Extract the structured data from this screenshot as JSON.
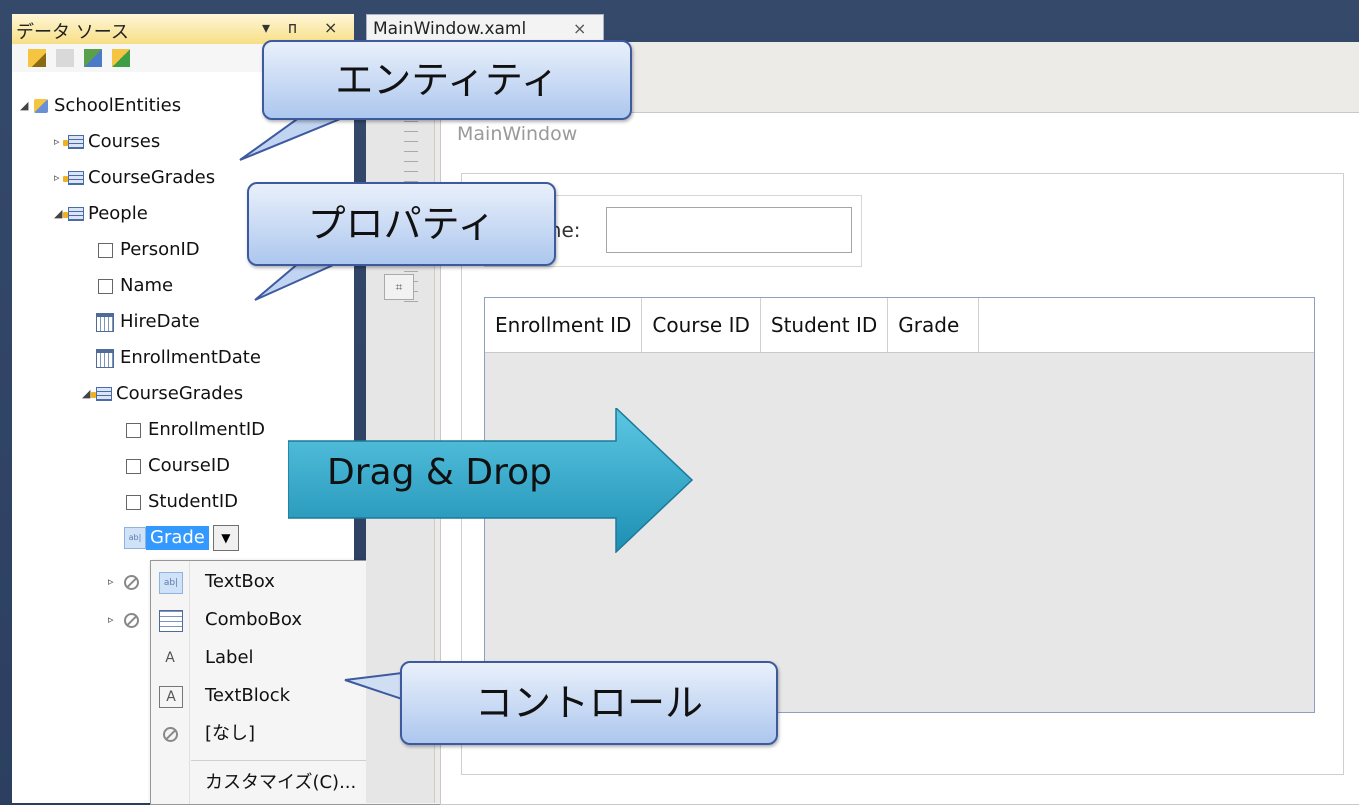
{
  "data_sources": {
    "title": "データ ソース",
    "pin_icon": "pin-icon",
    "close_label": "×",
    "tree": {
      "root": "SchoolEntities",
      "courses": "Courses",
      "course_grades": "CourseGrades",
      "people": "People",
      "person_id": "PersonID",
      "name": "Name",
      "hire_date": "HireDate",
      "enrollment_date": "EnrollmentDate",
      "people_course_grades": "CourseGrades",
      "enrollment_id": "EnrollmentID",
      "course_id": "CourseID",
      "student_id": "StudentID",
      "grade": "Grade"
    }
  },
  "context_menu": {
    "items": [
      "TextBox",
      "ComboBox",
      "Label",
      "TextBlock",
      "[なし]",
      "カスタマイズ(C)..."
    ]
  },
  "editor": {
    "tab_label": "MainWindow.xaml",
    "tab_close": "×",
    "window_title": "MainWindow",
    "name_label": "me:",
    "grid_columns": [
      "Enrollment ID",
      "Course ID",
      "Student ID",
      "Grade"
    ]
  },
  "callouts": {
    "entity": "エンティティ",
    "property": "プロパティ",
    "control": "コントロール",
    "drag_drop": "Drag & Drop"
  },
  "colors": {
    "callout_border": "#3d5a9e",
    "arrow_fill": "#2a9fc0",
    "selection": "#3399ff"
  }
}
